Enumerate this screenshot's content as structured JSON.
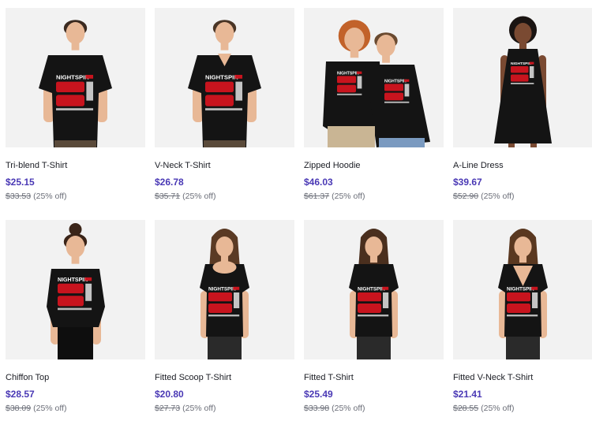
{
  "products": [
    {
      "title": "Tri-blend T-Shirt",
      "price": "$25.15",
      "original_price": "$33.53",
      "discount": "(25% off)",
      "garment": "tee",
      "model_hair": "#3b2a20",
      "model": "male",
      "print_text": "NIGHTSPIN"
    },
    {
      "title": "V-Neck T-Shirt",
      "price": "$26.78",
      "original_price": "$35.71",
      "discount": "(25% off)",
      "garment": "vneck",
      "model_hair": "#4a3526",
      "model": "male",
      "print_text": "NIGHTSPIN"
    },
    {
      "title": "Zipped Hoodie",
      "price": "$46.03",
      "original_price": "$61.37",
      "discount": "(25% off)",
      "garment": "hoodie",
      "model_hair": "#c2622a",
      "model": "pair",
      "print_text": "NIGHTSPIN"
    },
    {
      "title": "A-Line Dress",
      "price": "$39.67",
      "original_price": "$52.90",
      "discount": "(25% off)",
      "garment": "dress",
      "model_hair": "#1a1412",
      "model": "female-dark",
      "print_text": "NIGHTSPIN"
    },
    {
      "title": "Chiffon Top",
      "price": "$28.57",
      "original_price": "$38.09",
      "discount": "(25% off)",
      "garment": "chiffon",
      "model_hair": "#3a2418",
      "model": "female",
      "print_text": "NIGHTSPIN"
    },
    {
      "title": "Fitted Scoop T-Shirt",
      "price": "$20.80",
      "original_price": "$27.73",
      "discount": "(25% off)",
      "garment": "scoop",
      "model_hair": "#5a3a24",
      "model": "female",
      "print_text": "NIGHTSPIN"
    },
    {
      "title": "Fitted T-Shirt",
      "price": "$25.49",
      "original_price": "$33.98",
      "discount": "(25% off)",
      "garment": "fitted",
      "model_hair": "#4a2f1e",
      "model": "female",
      "print_text": "NIGHTSPIN"
    },
    {
      "title": "Fitted V-Neck T-Shirt",
      "price": "$21.41",
      "original_price": "$28.55",
      "discount": "(25% off)",
      "garment": "fvneck",
      "model_hair": "#5a3820",
      "model": "female",
      "print_text": "NIGHTSPIN"
    }
  ],
  "colors": {
    "price": "#4a39b5",
    "thumb_bg": "#f2f2f2",
    "garment": "#141414",
    "print_red": "#c8141e",
    "skin_light": "#e8b896",
    "skin_dark": "#7a4a32"
  }
}
